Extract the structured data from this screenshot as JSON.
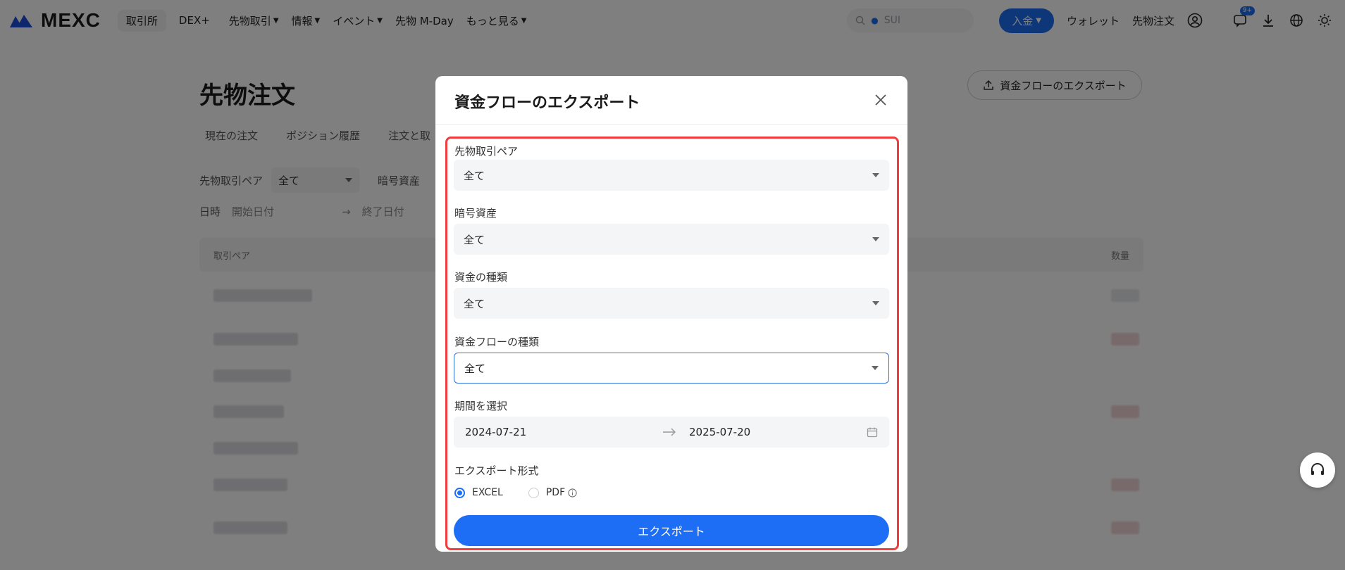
{
  "nav": {
    "logo_text": "MEXC",
    "pill_exchange": "取引所",
    "pill_dex": "DEX+",
    "items": [
      "先物取引",
      "情報",
      "イベント",
      "先物 M-Day",
      "もっと見る"
    ],
    "search_placeholder": "SUI",
    "deposit": "入金",
    "wallet": "ウォレット",
    "futures_orders": "先物注文",
    "notification_count": "9+"
  },
  "page": {
    "title": "先物注文",
    "export_button": "資金フローのエクスポート",
    "tabs": [
      "現在の注文",
      "ポジション履歴",
      "注文と取"
    ],
    "filter_pair_label": "先物取引ペア",
    "filter_pair_value": "全て",
    "filter_asset_label": "暗号資産",
    "date_label": "日時",
    "date_start_placeholder": "開始日付",
    "date_end_placeholder": "終了日付",
    "table_col_pair": "取引ペア",
    "table_col_qty": "数量"
  },
  "modal": {
    "title": "資金フローのエクスポート",
    "fields": {
      "pair_label": "先物取引ペア",
      "pair_value": "全て",
      "asset_label": "暗号資産",
      "asset_value": "全て",
      "fund_type_label": "資金の種類",
      "fund_type_value": "全て",
      "flow_type_label": "資金フローの種類",
      "flow_type_value": "全て",
      "period_label": "期間を選択",
      "period_start": "2024-07-21",
      "period_end": "2025-07-20",
      "format_label": "エクスポート形式",
      "format_excel": "EXCEL",
      "format_pdf": "PDF",
      "selected_format": "EXCEL"
    },
    "export_button": "エクスポート"
  },
  "colors": {
    "accent": "#1d6ef5",
    "highlight": "#ef3d3d"
  }
}
